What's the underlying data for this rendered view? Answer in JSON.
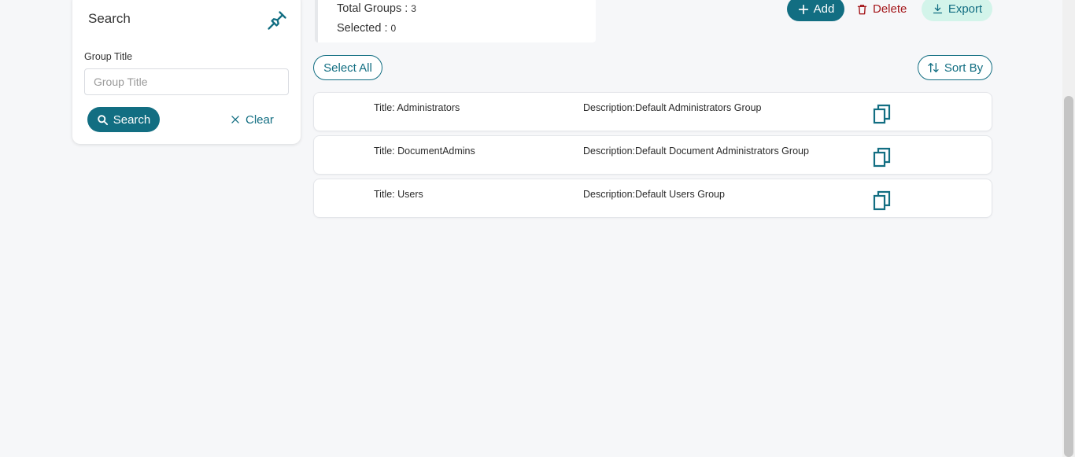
{
  "search_panel": {
    "title": "Search",
    "group_title_label": "Group Title",
    "group_title_placeholder": "Group Title",
    "group_title_value": "",
    "search_label": "Search",
    "clear_label": "Clear"
  },
  "summary": {
    "total_label": "Total Groups :",
    "total_value": "3",
    "selected_label": "Selected :",
    "selected_value": "0"
  },
  "actions": {
    "add_label": "Add",
    "delete_label": "Delete",
    "export_label": "Export",
    "select_all_label": "Select All",
    "sort_label": "Sort By"
  },
  "groups": [
    {
      "title": "Title: Administrators",
      "description": "Description:Default Administrators Group"
    },
    {
      "title": "Title: DocumentAdmins",
      "description": "Description:Default Document Administrators Group"
    },
    {
      "title": "Title: Users",
      "description": "Description:Default Users Group"
    }
  ],
  "colors": {
    "primary": "#126e82",
    "danger": "#a4161a",
    "export_bg": "#d3f4ea",
    "page_bg": "#f6f7f9"
  }
}
